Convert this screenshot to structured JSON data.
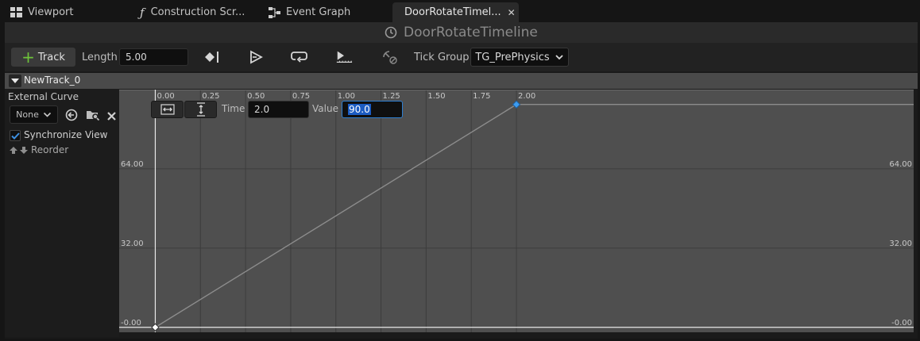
{
  "tabs": [
    {
      "label": "Viewport",
      "icon": "viewport-grid-icon"
    },
    {
      "label": "Construction Scr...",
      "icon": "function-icon"
    },
    {
      "label": "Event Graph",
      "icon": "graph-nodes-icon"
    },
    {
      "label": "DoorRotateTimel...",
      "icon": "clock-icon",
      "active": true,
      "close": "✕"
    }
  ],
  "editor": {
    "title": "DoorRotateTimeline",
    "title_icon": "clock-icon"
  },
  "toolbar": {
    "add_track_label": "Track",
    "length_label": "Length",
    "length_value": "5.00",
    "tick_group_label": "Tick Group",
    "tick_group_value": "TG_PrePhysics"
  },
  "track": {
    "name": "NewTrack_0",
    "external_curve_label": "External Curve",
    "external_curve_value": "None",
    "synchronize_view_label": "Synchronize View",
    "synchronize_view_checked": true,
    "reorder_label": "Reorder"
  },
  "key_editor": {
    "time_label": "Time",
    "time_value": "2.0",
    "value_label": "Value",
    "value_value": "90.0"
  },
  "curve": {
    "x_ticks": [
      "0.00",
      "0.25",
      "0.50",
      "0.75",
      "1.00",
      "1.25",
      "1.50",
      "1.75",
      "2.00"
    ],
    "x_tick_values": [
      0,
      0.25,
      0.5,
      0.75,
      1.0,
      1.25,
      1.5,
      1.75,
      2.0
    ],
    "y_ticks": [
      "-0.00",
      "32.00",
      "64.00"
    ],
    "y_tick_values": [
      0,
      32,
      64
    ],
    "x_range": [
      -0.2,
      4.2
    ],
    "y_range": [
      -2,
      96
    ],
    "keys": [
      {
        "time": 0.0,
        "value": 0.0,
        "selected": false
      },
      {
        "time": 2.0,
        "value": 90.0,
        "selected": true
      }
    ]
  },
  "colors": {
    "graph_bg": "#4f4f4f",
    "grid": "#3c3c3c",
    "curve": "#8c8c8c",
    "axis": "#e8e8e8",
    "selected_key": "#3d9cf0",
    "key": "#ffffff"
  }
}
